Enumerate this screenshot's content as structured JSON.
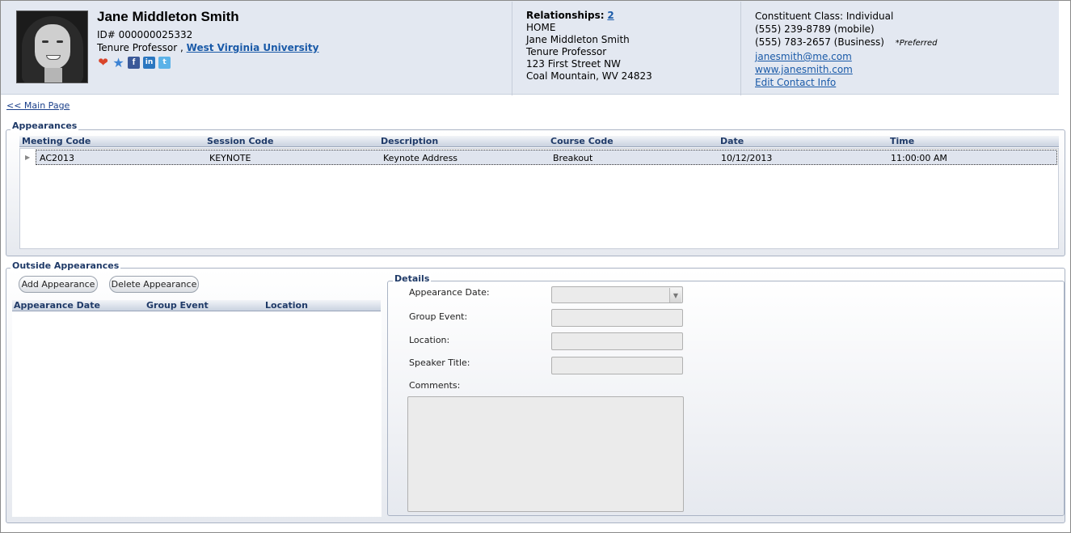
{
  "profile": {
    "name": "Jane Middleton Smith",
    "id_line": "ID# 000000025332",
    "title": "Tenure Professor ,",
    "organization": "West Virginia University",
    "icons": [
      "heart-icon",
      "star-icon",
      "facebook-icon",
      "linkedin-icon",
      "twitter-icon"
    ],
    "icon_glyphs": {
      "heart": "❤",
      "star": "★",
      "facebook": "f",
      "linkedin": "in",
      "twitter": "t"
    }
  },
  "relationships": {
    "label": "Relationships:",
    "count": "2",
    "address_type": "HOME",
    "address_name": "Jane Middleton Smith",
    "address_title": "Tenure Professor",
    "street": "123 First Street NW",
    "city_line": "Coal Mountain, WV 24823"
  },
  "contact": {
    "class": "Constituent Class: Individual",
    "phone_mobile": "(555) 239-8789 (mobile)",
    "phone_business": "(555) 783-2657 (Business)",
    "preferred": "*Preferred",
    "email": "janesmith@me.com",
    "website": "www.janesmith.com",
    "edit_link": "Edit Contact Info"
  },
  "nav": {
    "main_page": "<< Main Page"
  },
  "appearances": {
    "title": "Appearances",
    "columns": [
      "Meeting Code",
      "Session Code",
      "Description",
      "Course Code",
      "Date",
      "Time"
    ],
    "rows": [
      {
        "meeting_code": "AC2013",
        "session_code": "KEYNOTE",
        "description": "Keynote Address",
        "course_code": "Breakout",
        "date": "10/12/2013",
        "time": "11:00:00 AM"
      }
    ]
  },
  "outside_appearances": {
    "title": "Outside Appearances",
    "add_button": "Add Appearance",
    "delete_button": "Delete Appearance",
    "columns": [
      "Appearance Date",
      "Group Event",
      "Location"
    ]
  },
  "details": {
    "title": "Details",
    "appearance_date_label": "Appearance Date:",
    "group_event_label": "Group Event:",
    "location_label": "Location:",
    "speaker_title_label": "Speaker Title:",
    "comments_label": "Comments:",
    "appearance_date_value": "",
    "group_event_value": "",
    "location_value": "",
    "speaker_title_value": "",
    "comments_value": ""
  },
  "colors": {
    "header_bg": "#e3e8f1",
    "link": "#1a5aa8",
    "group_title": "#1f3a68"
  }
}
